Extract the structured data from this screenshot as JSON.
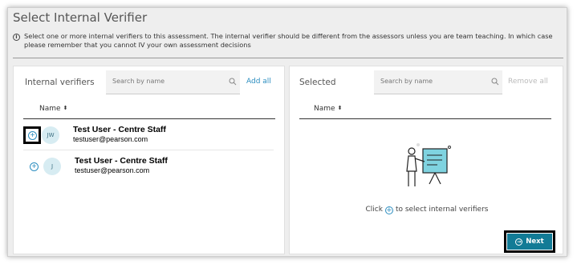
{
  "dialog": {
    "title": "Select Internal Verifier",
    "info_icon": "info-icon",
    "info_text": "Select one or more internal verifiers to this assessment. The internal verifier should be different from the assessors unless you are team teaching. In which case please remember that you cannot IV your own assessment decisions"
  },
  "left_panel": {
    "title": "Internal verifiers",
    "search_placeholder": "Search by name",
    "add_all_label": "Add all",
    "column_name": "Name",
    "sort_icon": "sort-icon",
    "rows": [
      {
        "initials": "JW",
        "name": "Test User - Centre Staff",
        "email": "testuser@pearson.com",
        "icon": "plus-circle-icon"
      },
      {
        "initials": "J",
        "name": "Test User - Centre Staff",
        "email": "testuser@pearson.com",
        "icon": "plus-circle-icon"
      }
    ]
  },
  "right_panel": {
    "title": "Selected",
    "search_placeholder": "Search by name",
    "remove_all_label": "Remove all",
    "column_name": "Name",
    "empty_illustration": "presenter-board-illustration",
    "hint_prefix": "Click",
    "hint_suffix": "to select internal verifiers",
    "next_label": "Next",
    "next_icon": "arrow-circle-icon"
  },
  "colors": {
    "accent": "#2c8ec0",
    "button": "#127b96",
    "avatar_bg": "#d7ecf2",
    "illustration_fill": "#7fd3e0"
  }
}
